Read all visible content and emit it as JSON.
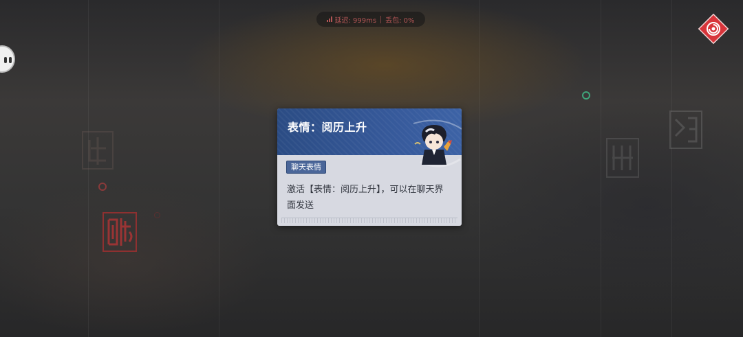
{
  "hud": {
    "latency_label": "延迟: 999ms",
    "packet_loss_label": "丢包: 0%",
    "status_color": "#b25555",
    "corner_button_icon": "spiral-emblem-icon",
    "corner_button_color": "#d8343a",
    "side_handle_icon": "eyes-icon"
  },
  "popup": {
    "title": "表情：阅历上升",
    "tag": "聊天表情",
    "description": "激活【表情：阅历上升】，可以在聊天界面发送",
    "header_color": "#2b4c84",
    "art_icon": "chibi-character-emote-icon"
  },
  "background": {
    "seals": [
      "red-seal-left",
      "faded-seal-left",
      "faded-seal-right",
      "faded-seal-far-right"
    ]
  }
}
